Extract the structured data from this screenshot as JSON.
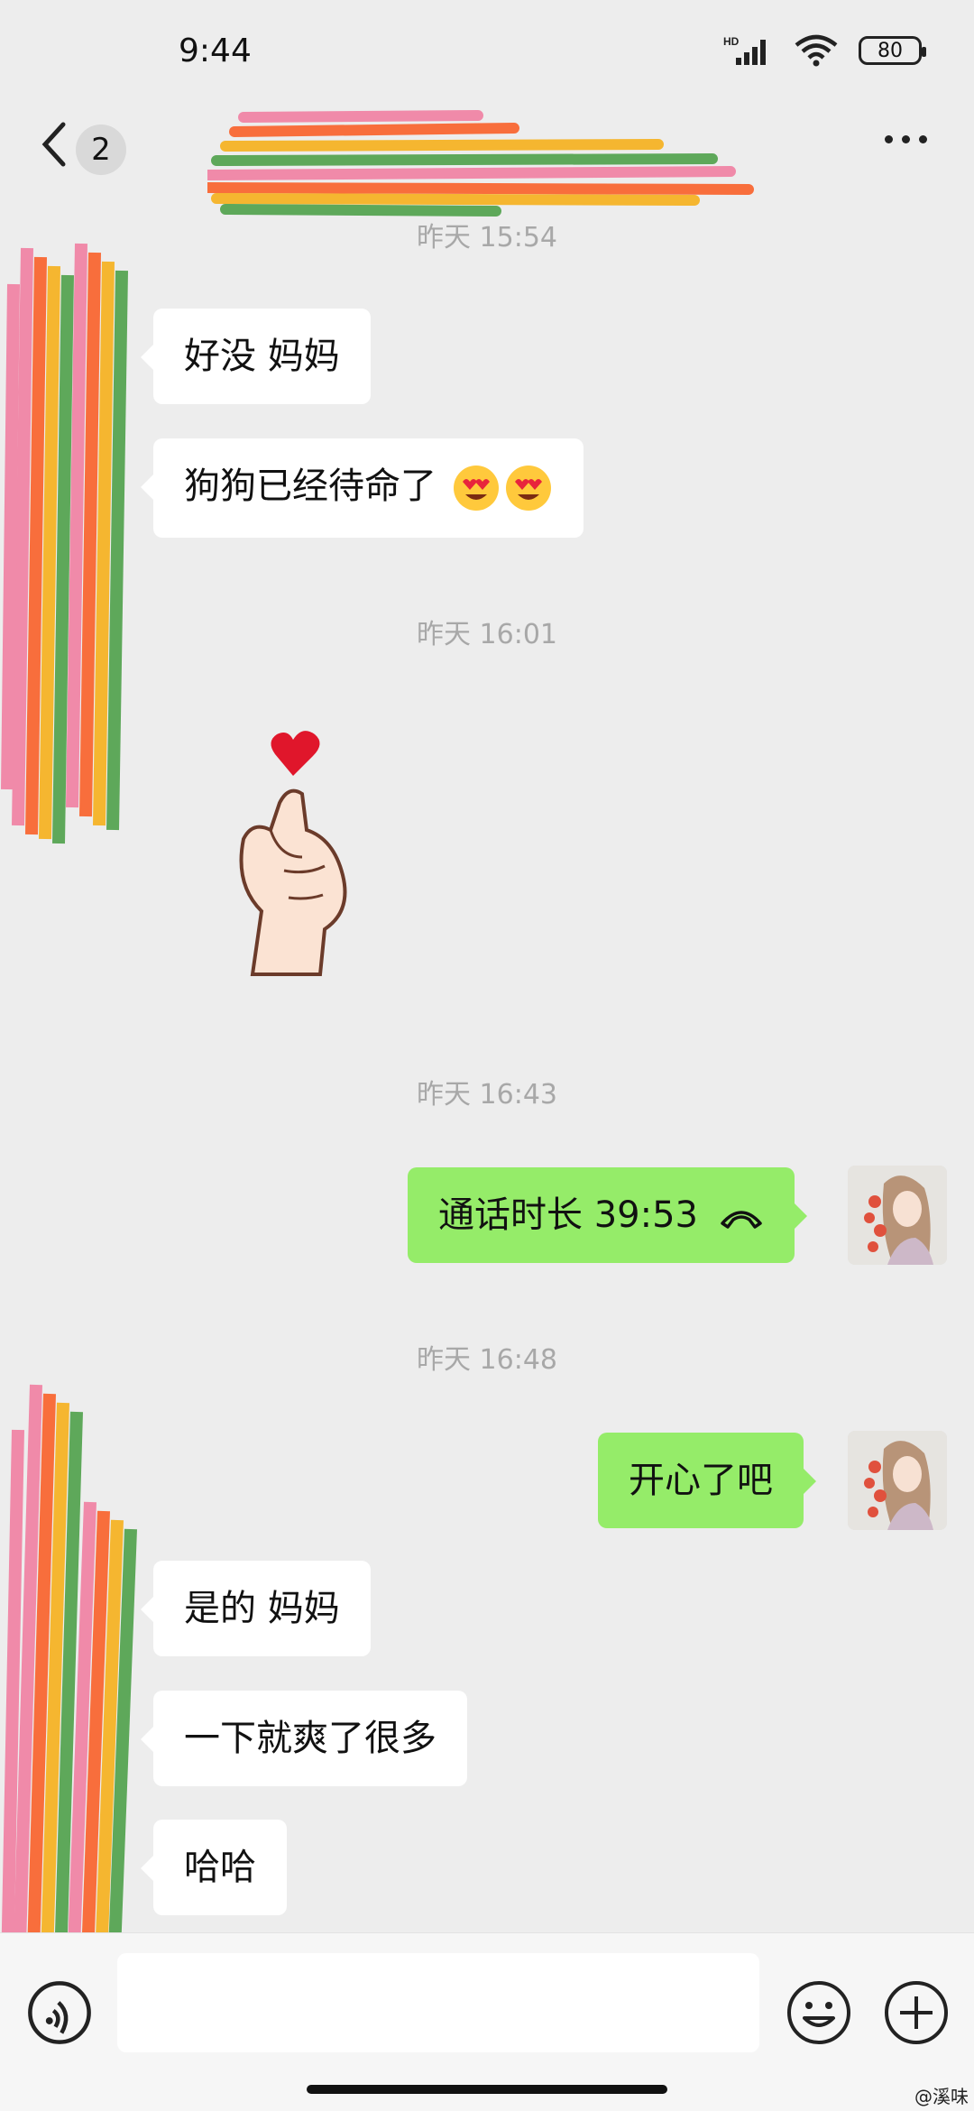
{
  "status_bar": {
    "time": "9:44",
    "network": "HD",
    "battery": "80"
  },
  "header": {
    "unread_count": "2"
  },
  "messages": {
    "ts1": "昨天 15:54",
    "m1": "好没 妈妈",
    "m2": "狗狗已经待命了",
    "ts2": "昨天 16:01",
    "ts3": "昨天 16:43",
    "call": "通话时长 39:53",
    "ts4": "昨天 16:48",
    "m3": "开心了吧",
    "m4": "是的 妈妈",
    "m5": "一下就爽了很多",
    "m6": "哈哈"
  },
  "icons": {
    "back": "chevron-left-icon",
    "more": "more-dots-icon",
    "call": "phone-hangup-icon",
    "voice": "voice-icon",
    "emoji": "emoji-icon",
    "plus": "plus-icon"
  },
  "colors": {
    "background": "#ededed",
    "incoming_bubble": "#ffffff",
    "outgoing_bubble": "#95ec69"
  },
  "watermark": "@溪味"
}
